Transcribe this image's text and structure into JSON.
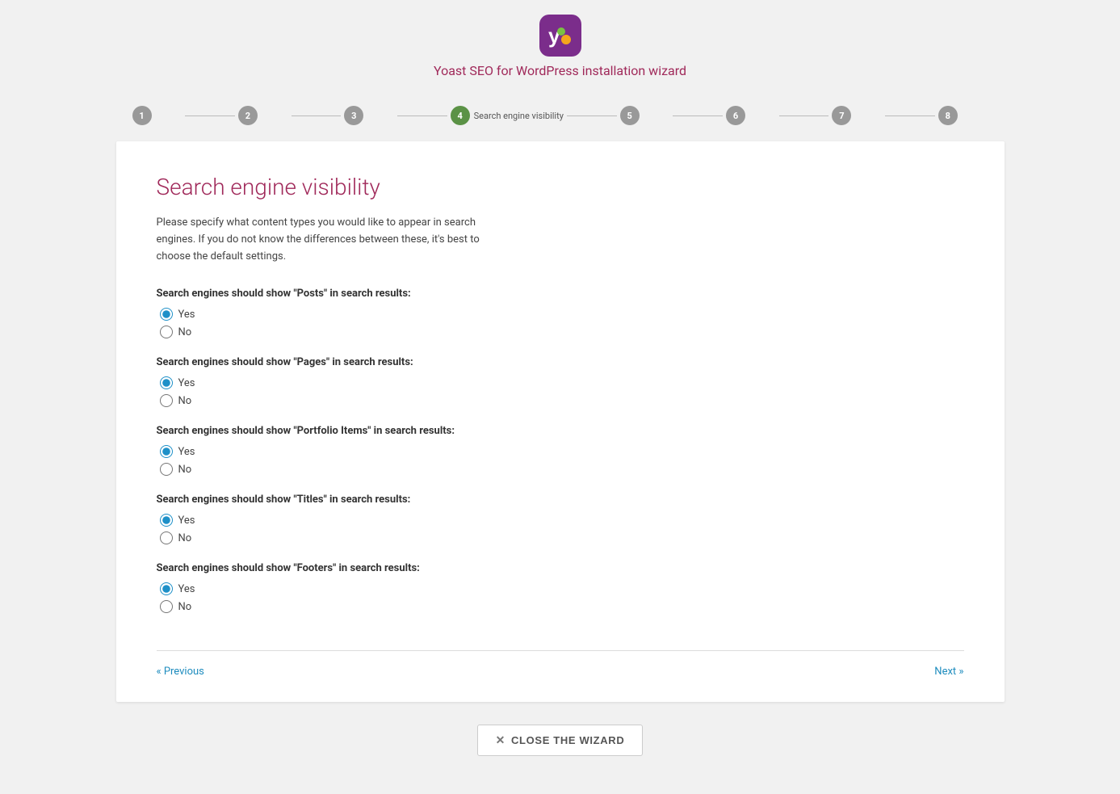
{
  "header": {
    "title": "Yoast SEO for WordPress installation wizard"
  },
  "stepper": {
    "steps": [
      {
        "number": "1",
        "label": "",
        "active": false
      },
      {
        "number": "2",
        "label": "",
        "active": false
      },
      {
        "number": "3",
        "label": "",
        "active": false
      },
      {
        "number": "4",
        "label": "Search engine visibility",
        "active": true
      },
      {
        "number": "5",
        "label": "",
        "active": false
      },
      {
        "number": "6",
        "label": "",
        "active": false
      },
      {
        "number": "7",
        "label": "",
        "active": false
      },
      {
        "number": "8",
        "label": "",
        "active": false
      }
    ]
  },
  "card": {
    "title": "Search engine visibility",
    "description": "Please specify what content types you would like to appear in search engines. If you do not know the differences between these, it's best to choose the default settings.",
    "sections": [
      {
        "label": "Search engines should show \"Posts\" in search results:",
        "name": "posts",
        "options": [
          "Yes",
          "No"
        ],
        "selected": "Yes"
      },
      {
        "label": "Search engines should show \"Pages\" in search results:",
        "name": "pages",
        "options": [
          "Yes",
          "No"
        ],
        "selected": "Yes"
      },
      {
        "label": "Search engines should show \"Portfolio Items\" in search results:",
        "name": "portfolio",
        "options": [
          "Yes",
          "No"
        ],
        "selected": "Yes"
      },
      {
        "label": "Search engines should show \"Titles\" in search results:",
        "name": "titles",
        "options": [
          "Yes",
          "No"
        ],
        "selected": "Yes"
      },
      {
        "label": "Search engines should show \"Footers\" in search results:",
        "name": "footers",
        "options": [
          "Yes",
          "No"
        ],
        "selected": "Yes"
      }
    ],
    "nav": {
      "previous": "« Previous",
      "next": "Next »"
    }
  },
  "close_wizard": {
    "label": "CLOSE THE WIZARD",
    "icon": "✕"
  }
}
